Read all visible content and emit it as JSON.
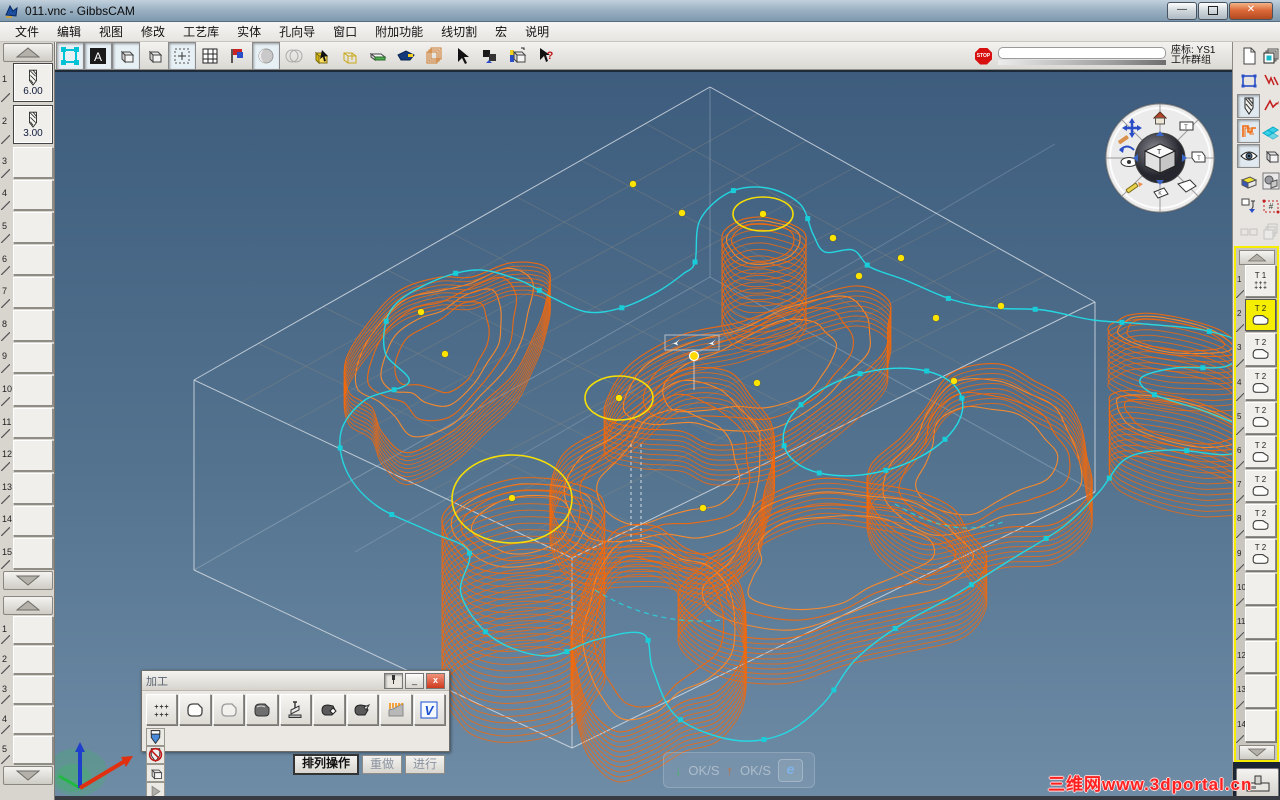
{
  "colors": {
    "toolpath": "#f2690d",
    "toolpath_light": "#ff8a28",
    "geometry": "#22dce6",
    "marker": "#19cdd8",
    "highlight": "#ffe400",
    "selected_op": "#f5ee00",
    "viewport_top": "#3e5d7e",
    "viewport_bottom": "#6f8ca6",
    "stock": "#d4dbe2",
    "watermark_red": "#ff2020"
  },
  "window": {
    "title": "011.vnc - GibbsCAM",
    "minimize_label": "—",
    "close_label": "✕"
  },
  "menu": {
    "items": [
      "文件",
      "编辑",
      "视图",
      "修改",
      "工艺库",
      "实体",
      "孔向导",
      "窗口",
      "附加功能",
      "线切割",
      "宏",
      "说明"
    ]
  },
  "toolbar": {
    "stop_label": "STOP",
    "coord_label": "座标: YS1",
    "group_label": "工作群组",
    "icons": [
      "selection-frame-icon",
      "label-select-icon",
      "cube-shaded-icon",
      "cube-flat-icon",
      "point-select-icon",
      "grid-icon",
      "flag-icon",
      "moon-icon",
      "circles-icon",
      "cube-pick-icon",
      "cube-wire-icon",
      "slab-icon",
      "marker-icon",
      "sheet-stack-icon",
      "pointer-icon",
      "swap-icon",
      "cube-axis-icon",
      "help-pointer-icon"
    ]
  },
  "left_toolbar": {
    "tools": [
      {
        "num": "1",
        "label": "6.00",
        "has_tool": true
      },
      {
        "num": "2",
        "label": "3.00",
        "has_tool": true
      },
      {
        "num": "3"
      },
      {
        "num": "4"
      },
      {
        "num": "5"
      },
      {
        "num": "6"
      },
      {
        "num": "7"
      },
      {
        "num": "8"
      },
      {
        "num": "9"
      },
      {
        "num": "10"
      },
      {
        "num": "11"
      },
      {
        "num": "12"
      },
      {
        "num": "13"
      },
      {
        "num": "14"
      },
      {
        "num": "15"
      }
    ],
    "workgroups": [
      {
        "num": "1"
      },
      {
        "num": "2"
      },
      {
        "num": "3"
      },
      {
        "num": "4"
      },
      {
        "num": "5"
      }
    ]
  },
  "right_toolbar": {
    "icons": [
      {
        "name": "document-icon"
      },
      {
        "name": "workgroup-stack-icon"
      },
      {
        "name": "select-rect-icon"
      },
      {
        "name": "measure-icon"
      },
      {
        "name": "tool-icon",
        "pressed": true
      },
      {
        "name": "profile-icon"
      },
      {
        "name": "toolpath-icon",
        "pressed": true
      },
      {
        "name": "surface-icon"
      },
      {
        "name": "eye-icon",
        "pressed": true
      },
      {
        "name": "cube-icon"
      },
      {
        "name": "solid-icon"
      },
      {
        "name": "render-icon"
      },
      {
        "name": "post-icon"
      },
      {
        "name": "point-frame-icon"
      },
      {
        "name": "pair-icon",
        "disabled": true
      },
      {
        "name": "layer-stack-icon",
        "disabled": true
      }
    ]
  },
  "operations": {
    "slots": [
      {
        "num": "1",
        "tool": "T 1",
        "glyph": "drill"
      },
      {
        "num": "2",
        "tool": "T 2",
        "glyph": "contour",
        "selected": true
      },
      {
        "num": "3",
        "tool": "T 2",
        "glyph": "contour"
      },
      {
        "num": "4",
        "tool": "T 2",
        "glyph": "contour"
      },
      {
        "num": "5",
        "tool": "T 2",
        "glyph": "contour"
      },
      {
        "num": "6",
        "tool": "T 2",
        "glyph": "contour"
      },
      {
        "num": "7",
        "tool": "T 2",
        "glyph": "contour"
      },
      {
        "num": "8",
        "tool": "T 2",
        "glyph": "contour"
      },
      {
        "num": "9",
        "tool": "T 2",
        "glyph": "contour"
      },
      {
        "num": "10"
      },
      {
        "num": "11"
      },
      {
        "num": "12"
      },
      {
        "num": "13"
      },
      {
        "num": "14"
      }
    ]
  },
  "palette": {
    "title": "加工",
    "arrange_label": "排列操作",
    "redo_label": "重做",
    "proceed_label": "进行",
    "icons": [
      "drill-points-icon",
      "contour-icon",
      "pocket-icon",
      "surface-mill-icon",
      "flange-icon",
      "solid-mill-icon",
      "engrave-icon",
      "thread-mill-icon",
      "volumill-icon"
    ],
    "small_icons": [
      "tool-show-icon",
      "tool-hide-icon",
      "stock-icon",
      "play-icon"
    ]
  },
  "overlay": {
    "feed_down_label": "OK/S",
    "feed_up_label": "OK/S",
    "browser_label": "e"
  },
  "trackball": {
    "center_label": "T"
  },
  "watermark": {
    "text": "三维网www.3dportal.cn"
  }
}
